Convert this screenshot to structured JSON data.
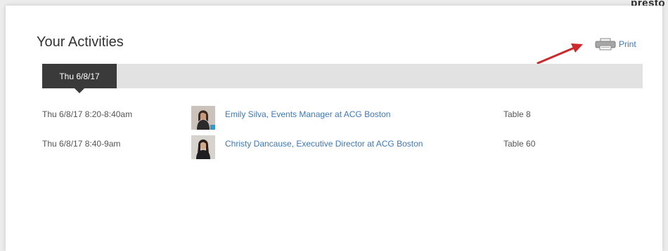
{
  "brand": {
    "partial_text": "presto"
  },
  "activities": {
    "title": "Your Activities",
    "print_label": "Print",
    "print_icon": "printer-icon",
    "date_tabs": [
      {
        "label": "Thu 6/8/17",
        "selected": true
      }
    ],
    "rows": [
      {
        "time": "Thu 6/8/17 8:20-8:40am",
        "person": "Emily Silva, Events Manager at ACG Boston",
        "table": "Table 8"
      },
      {
        "time": "Thu 6/8/17 8:40-9am",
        "person": "Christy Dancause, Executive Director at ACG Boston",
        "table": "Table 60"
      }
    ]
  },
  "colors": {
    "link": "#3b78c2",
    "tab_active_bg": "#3a3a3a",
    "tabbar_bg": "#e2e2e2",
    "annotation_arrow": "#d0282a"
  }
}
